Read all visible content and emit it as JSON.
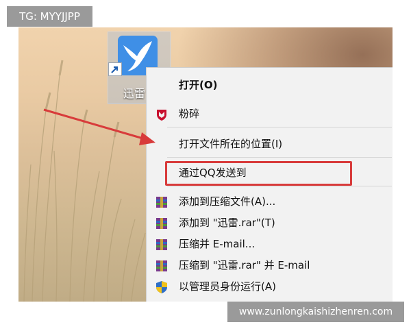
{
  "overlay": {
    "tg_tag": "TG: MYYJJPP",
    "watermark_url": "www.zunlongkaishizhenren.com"
  },
  "desktop": {
    "icon_label": "迅雷",
    "icon_name": "xunlei-bird-icon",
    "icon_color": "#3f8fe6"
  },
  "context_menu": {
    "items": [
      {
        "label": "打开(O)",
        "icon": null
      },
      {
        "label": "粉碎",
        "icon": "mcafee-shield-icon"
      },
      {
        "label": "打开文件所在的位置(I)",
        "icon": null,
        "highlighted": true
      },
      {
        "label": "通过QQ发送到",
        "icon": null
      },
      {
        "label": "添加到压缩文件(A)...",
        "icon": "winrar-archive-icon"
      },
      {
        "label": "添加到 \"迅雷.rar\"(T)",
        "icon": "winrar-archive-icon"
      },
      {
        "label": "压缩并 E-mail...",
        "icon": "winrar-archive-icon"
      },
      {
        "label": "压缩到 \"迅雷.rar\" 并 E-mail",
        "icon": "winrar-archive-icon"
      },
      {
        "label": "以管理员身份运行(A)",
        "icon": "uac-shield-icon"
      }
    ]
  },
  "annotation": {
    "arrow_color": "#d83b3b",
    "box_color": "#d83b3b"
  }
}
